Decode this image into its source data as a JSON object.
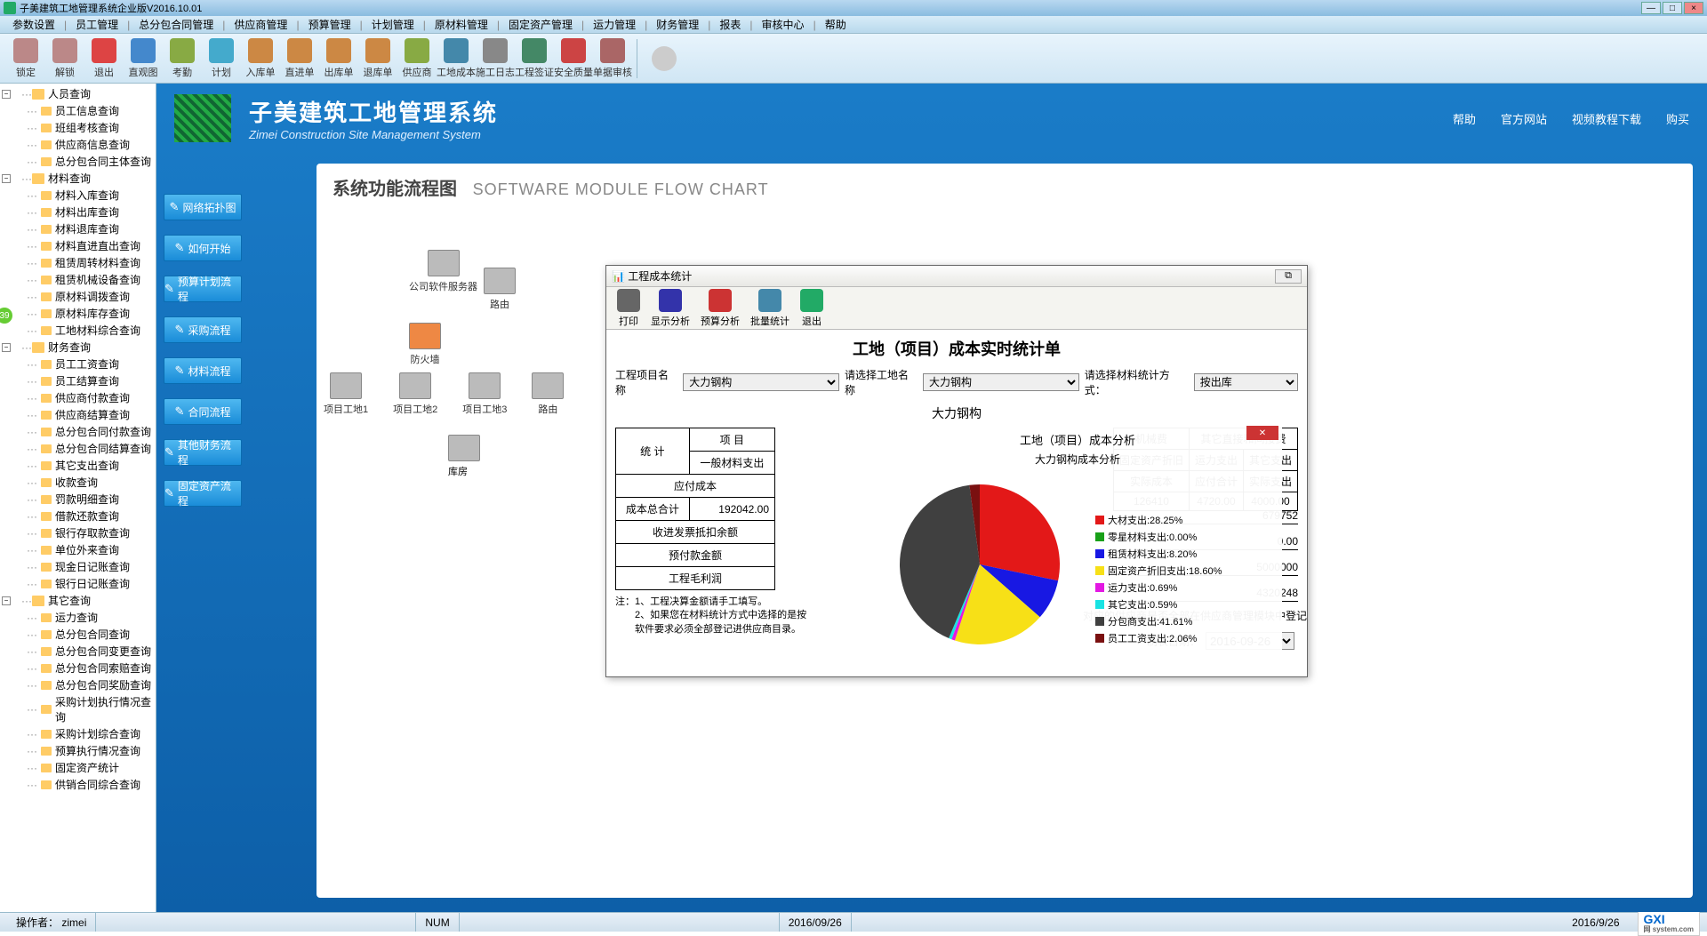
{
  "window": {
    "title": "子美建筑工地管理系统企业版V2016.10.01",
    "min": "—",
    "max": "□",
    "close": "×"
  },
  "menubar": [
    "参数设置",
    "员工管理",
    "总分包合同管理",
    "供应商管理",
    "预算管理",
    "计划管理",
    "原材料管理",
    "固定资产管理",
    "运力管理",
    "财务管理",
    "报表",
    "审核中心",
    "帮助"
  ],
  "toolbar": [
    {
      "label": "锁定",
      "color": "#b88"
    },
    {
      "label": "解锁",
      "color": "#b88"
    },
    {
      "label": "退出",
      "color": "#d44"
    },
    {
      "label": "直观图",
      "color": "#48c"
    },
    {
      "label": "考勤",
      "color": "#8a4"
    },
    {
      "label": "计划",
      "color": "#4ac"
    },
    {
      "label": "入库单",
      "color": "#c84"
    },
    {
      "label": "直进单",
      "color": "#c84"
    },
    {
      "label": "出库单",
      "color": "#c84"
    },
    {
      "label": "退库单",
      "color": "#c84"
    },
    {
      "label": "供应商",
      "color": "#8a4"
    },
    {
      "label": "工地成本",
      "color": "#48a"
    },
    {
      "label": "施工日志",
      "color": "#888"
    },
    {
      "label": "工程签证",
      "color": "#486"
    },
    {
      "label": "安全质量",
      "color": "#c44"
    },
    {
      "label": "单据审核",
      "color": "#a66"
    }
  ],
  "badge": "39",
  "tree": [
    {
      "label": "人员查询",
      "items": [
        "员工信息查询",
        "班组考核查询",
        "供应商信息查询",
        "总分包合同主体查询"
      ]
    },
    {
      "label": "材料查询",
      "items": [
        "材料入库查询",
        "材料出库查询",
        "材料退库查询",
        "材料直进直出查询",
        "租赁周转材料查询",
        "租赁机械设备查询",
        "原材料调拨查询",
        "原材料库存查询",
        "工地材料综合查询"
      ]
    },
    {
      "label": "财务查询",
      "items": [
        "员工工资查询",
        "员工结算查询",
        "供应商付款查询",
        "供应商结算查询",
        "总分包合同付款查询",
        "总分包合同结算查询",
        "其它支出查询",
        "收款查询",
        "罚款明细查询",
        "借款还款查询",
        "银行存取款查询",
        "单位外来查询",
        "现金日记账查询",
        "银行日记账查询"
      ]
    },
    {
      "label": "其它查询",
      "items": [
        "运力查询",
        "总分包合同查询",
        "总分包合同变更查询",
        "总分包合同索赔查询",
        "总分包合同奖励查询",
        "采购计划执行情况查询",
        "采购计划综合查询",
        "预算执行情况查询",
        "固定资产统计",
        "供销合同综合查询"
      ]
    }
  ],
  "brand": {
    "title": "子美建筑工地管理系统",
    "subtitle": "Zimei Construction Site Management System"
  },
  "header_links": [
    "帮助",
    "官方网站",
    "视频教程下载",
    "购买"
  ],
  "flow_buttons": [
    "网络拓扑图",
    "如何开始",
    "预算计划流程",
    "采购流程",
    "材料流程",
    "合同流程",
    "其他财务流程",
    "固定资产流程"
  ],
  "flowchart": {
    "title": "系统功能流程图",
    "title_en": "SOFTWARE MODULE FLOW CHART",
    "server": "公司软件服务器",
    "firewall": "防火墙",
    "router": "路由",
    "sites": [
      "项目工地1",
      "项目工地2",
      "项目工地3",
      "路由"
    ],
    "warehouse": "库房"
  },
  "modal": {
    "title": "工程成本统计",
    "close": "⧉",
    "tools": [
      {
        "label": "打印",
        "color": "#666"
      },
      {
        "label": "显示分析",
        "color": "#33a"
      },
      {
        "label": "预算分析",
        "color": "#c33"
      },
      {
        "label": "批量统计",
        "color": "#48a"
      },
      {
        "label": "退出",
        "color": "#2a6"
      }
    ],
    "report_title": "工地（项目）成本实时统计单",
    "filters": {
      "l1": "工程项目名称",
      "v1": "大力钢构",
      "l2": "请选择工地名称",
      "v2": "大力钢构",
      "l3": "请选择材料统计方式：",
      "v3": "按出库"
    },
    "project": "大力钢构",
    "left_table": {
      "header1": "项  目",
      "header2": "统  计",
      "r1a": "一般材料支出",
      "r1b": "应付成本",
      "r1v": "192042.00",
      "rows": [
        "成本总合计",
        "收进发票抵扣余额",
        "预付款金额",
        "工程毛利润"
      ]
    },
    "right_table": {
      "h1": "机械费",
      "h2": "其它直接和间接费",
      "r1": "固定资产折旧",
      "r2": "运力支出",
      "r3": "其它支出",
      "r4": "实际成本",
      "r5": "应付合计",
      "r6": "实际支出",
      "v1": "126410",
      "v2": "4720.00",
      "v3": "4000.00"
    },
    "right_vals": [
      "679752",
      "0.00",
      "5000000",
      "4320248"
    ],
    "note1": "注：1、工程决算金额请手工填写。",
    "note2": "　　2、如果您在材料统计方式中选择的是按",
    "note3": "　　软件要求必须全部登记进供应商目录。",
    "supplier_note": "对应的供应商是否全部在供应商管理模块中登记",
    "date_label": "制表日期：",
    "date_value": "2016-09-26"
  },
  "chart_data": {
    "type": "pie",
    "title": "工地（项目）成本分析",
    "subtitle": "大力钢构成本分析",
    "series": [
      {
        "name": "大材支出",
        "value": 28.25,
        "color": "#e31818"
      },
      {
        "name": "零星材料支出",
        "value": 0.0,
        "color": "#18a018"
      },
      {
        "name": "租赁材料支出",
        "value": 8.2,
        "color": "#1818e3"
      },
      {
        "name": "固定资产折旧支出",
        "value": 18.6,
        "color": "#f7e017"
      },
      {
        "name": "运力支出",
        "value": 0.69,
        "color": "#e318e3"
      },
      {
        "name": "其它支出",
        "value": 0.59,
        "color": "#18e3e3"
      },
      {
        "name": "分包商支出",
        "value": 41.61,
        "color": "#404040"
      },
      {
        "name": "员工工资支出",
        "value": 2.06,
        "color": "#7a1010"
      }
    ]
  },
  "statusbar": {
    "operator_label": "操作者：",
    "operator": "zimei",
    "num": "NUM",
    "date1": "2016/09/26",
    "date2": "2016/9/26",
    "logo": "GXI",
    "logo_sub": "网 system.com"
  }
}
